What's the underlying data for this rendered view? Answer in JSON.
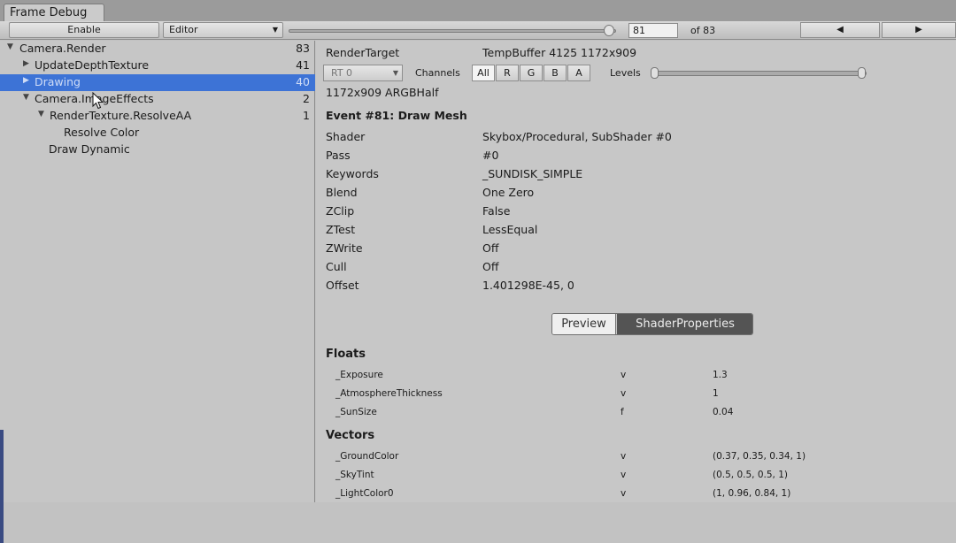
{
  "window": {
    "tab_title": "Frame Debug"
  },
  "toolbar": {
    "enable_label": "Enable",
    "target_value": "Editor",
    "frame_value": "81",
    "of_label": "of 83",
    "slider_fraction": 0.976,
    "prev_glyph": "◀",
    "next_glyph": "▶"
  },
  "tree": {
    "items": [
      {
        "label": "Camera.Render",
        "count": "83",
        "toggle": "▼"
      },
      {
        "label": "UpdateDepthTexture",
        "count": "41",
        "toggle": "▶"
      },
      {
        "label": "Drawing",
        "count": "40",
        "toggle": "▶",
        "selected": true
      },
      {
        "label": "Camera.ImageEffects",
        "count": "2",
        "toggle": "▼"
      },
      {
        "label": "RenderTexture.ResolveAA",
        "count": "1",
        "toggle": "▼"
      },
      {
        "label": "Resolve Color",
        "count": "",
        "toggle": ""
      },
      {
        "label": "Draw Dynamic",
        "count": "",
        "toggle": ""
      }
    ]
  },
  "details": {
    "render_target_label": "RenderTarget",
    "render_target_value": "TempBuffer 4125 1172x909",
    "rt_dropdown": "RT 0",
    "channels_label": "Channels",
    "channel_buttons": [
      "All",
      "R",
      "G",
      "B",
      "A"
    ],
    "levels_label": "Levels",
    "format": "1172x909 ARGBHalf",
    "event_title": "Event #81: Draw Mesh",
    "properties": [
      {
        "key": "Shader",
        "value": "Skybox/Procedural, SubShader #0"
      },
      {
        "key": "Pass",
        "value": "#0"
      },
      {
        "key": "Keywords",
        "value": "_SUNDISK_SIMPLE"
      },
      {
        "key": "Blend",
        "value": "One Zero"
      },
      {
        "key": "ZClip",
        "value": "False"
      },
      {
        "key": "ZTest",
        "value": "LessEqual"
      },
      {
        "key": "ZWrite",
        "value": "Off"
      },
      {
        "key": "Cull",
        "value": "Off"
      },
      {
        "key": "Offset",
        "value": "1.401298E-45, 0"
      }
    ],
    "tabs": {
      "preview": "Preview",
      "shader_properties": "ShaderProperties"
    },
    "floats_title": "Floats",
    "floats": [
      {
        "name": "_Exposure",
        "type": "v",
        "value": "1.3"
      },
      {
        "name": "_AtmosphereThickness",
        "type": "v",
        "value": "1"
      },
      {
        "name": "_SunSize",
        "type": "f",
        "value": "0.04"
      }
    ],
    "vectors_title": "Vectors",
    "vectors": [
      {
        "name": "_GroundColor",
        "type": "v",
        "value": "(0.37, 0.35, 0.34, 1)"
      },
      {
        "name": "_SkyTint",
        "type": "v",
        "value": "(0.5, 0.5, 0.5, 1)"
      },
      {
        "name": "_LightColor0",
        "type": "v",
        "value": "(1, 0.96, 0.84, 1)"
      }
    ]
  },
  "colors": {
    "selection": "#3d73d6",
    "active_tab": "#545454"
  }
}
